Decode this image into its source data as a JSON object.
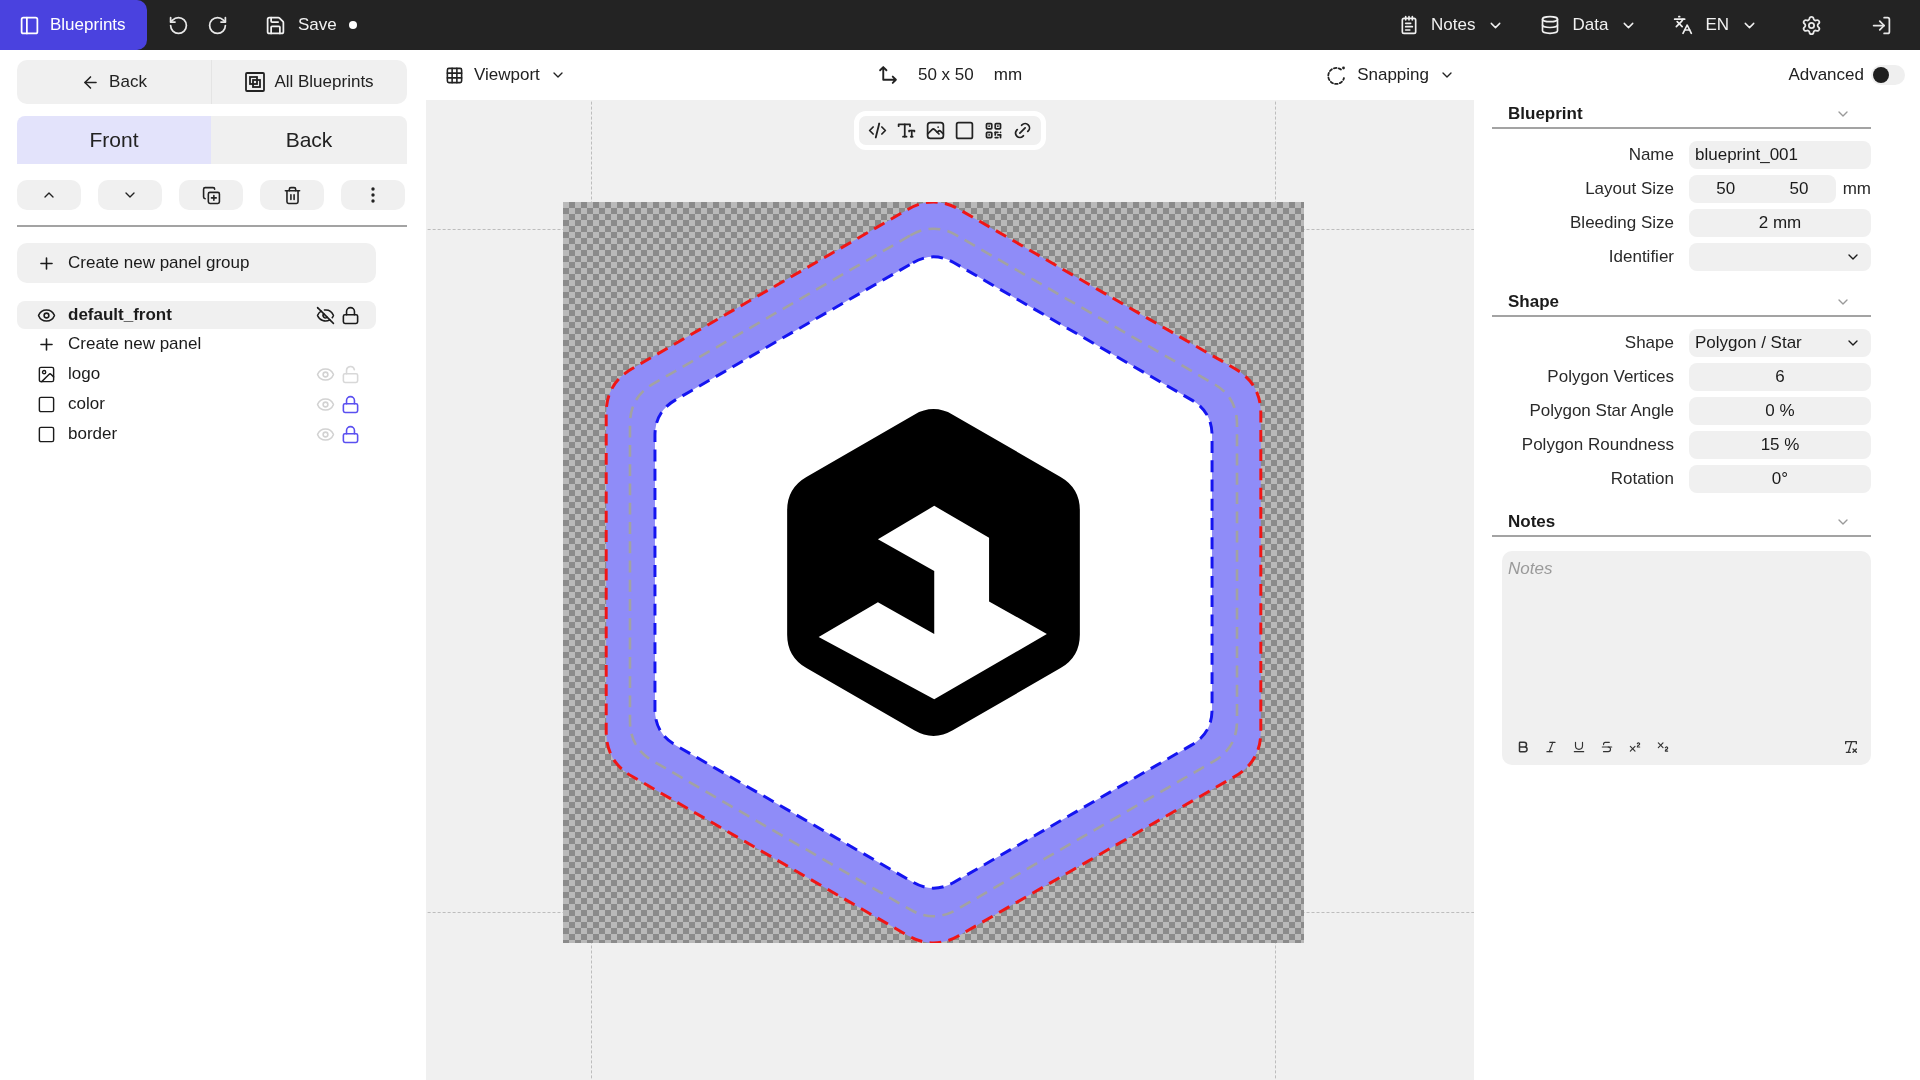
{
  "topbar": {
    "app_button": {
      "label": "Blueprints"
    },
    "save": {
      "label": "Save",
      "unsaved": true
    },
    "menus": [
      {
        "label": "Notes",
        "kind": "notes"
      },
      {
        "label": "Data",
        "kind": "data"
      },
      {
        "label": "EN",
        "kind": "language"
      }
    ]
  },
  "sidebar": {
    "nav": [
      {
        "label": "Back",
        "kind": "back"
      },
      {
        "label": "All Blueprints",
        "kind": "all"
      }
    ],
    "tabs": [
      {
        "label": "Front",
        "selected": true
      },
      {
        "label": "Back",
        "selected": false
      }
    ],
    "create_group": {
      "label": "Create new panel group"
    },
    "group": {
      "name": "default_front",
      "create_panel": "Create new panel",
      "panels": [
        {
          "name": "logo",
          "kind": "image",
          "locked": false
        },
        {
          "name": "color",
          "kind": "shape",
          "locked": true
        },
        {
          "name": "border",
          "kind": "shape",
          "locked": true
        }
      ]
    }
  },
  "canvas": {
    "viewport": "Viewport",
    "size": "50 x 50",
    "unit": "mm",
    "snapping": "Snapping"
  },
  "inspector": {
    "advanced": {
      "label": "Advanced",
      "on": false
    },
    "sections": [
      {
        "title": "Blueprint",
        "fields": [
          {
            "label": "Name",
            "kind": "text",
            "value": "blueprint_001"
          },
          {
            "label": "Layout Size",
            "kind": "pair",
            "values": [
              "50",
              "50"
            ],
            "unit": "mm"
          },
          {
            "label": "Bleeding Size",
            "kind": "number",
            "value": "2 mm"
          },
          {
            "label": "Identifier",
            "kind": "select"
          }
        ]
      },
      {
        "title": "Shape",
        "fields": [
          {
            "label": "Shape",
            "kind": "select",
            "value": "Polygon / Star"
          },
          {
            "label": "Polygon Vertices",
            "kind": "number",
            "value": "6"
          },
          {
            "label": "Polygon Star Angle",
            "kind": "number",
            "value": "0 %"
          },
          {
            "label": "Polygon Roundness",
            "kind": "number",
            "value": "15 %"
          },
          {
            "label": "Rotation",
            "kind": "number",
            "value": "0°"
          }
        ]
      }
    ],
    "notes": {
      "title": "Notes",
      "placeholder": "Notes"
    }
  }
}
